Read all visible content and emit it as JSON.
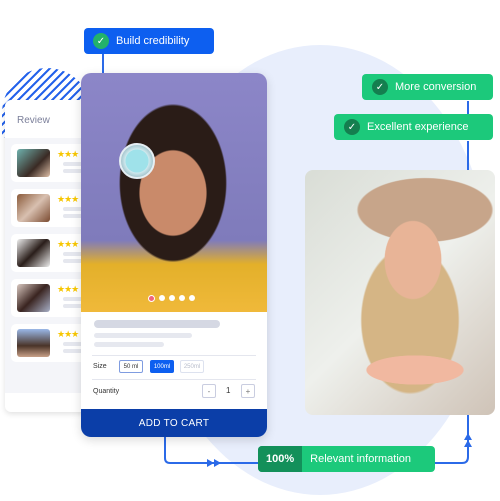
{
  "tags": {
    "build_credibility": "Build credibility",
    "more_conversion": "More conversion",
    "excellent_experience": "Excellent experience",
    "relevant_percent": "100%",
    "relevant_information": "Relevant information"
  },
  "icons": {
    "check": "✓",
    "star": "★★★"
  },
  "review": {
    "title": "Review",
    "items": [
      {
        "stars": "★★★"
      },
      {
        "stars": "★★★"
      },
      {
        "stars": "★★★"
      },
      {
        "stars": "★★★"
      },
      {
        "stars": "★★★"
      }
    ]
  },
  "product": {
    "carousel_total": 5,
    "carousel_active": 1,
    "size_label": "Size",
    "sizes": [
      {
        "label": "50 ml",
        "state": "default"
      },
      {
        "label": "100ml",
        "state": "selected"
      },
      {
        "label": "250ml",
        "state": "disabled"
      }
    ],
    "quantity_label": "Quantity",
    "quantity_minus": "-",
    "quantity_value": "1",
    "quantity_plus": "+",
    "add_to_cart": "ADD TO CART"
  },
  "colors": {
    "primary_blue": "#0d5ff0",
    "cart_blue": "#0b3ea8",
    "green": "#1cc97b",
    "dark_green": "#13905a",
    "star": "#f7c600",
    "connector": "#2b6ae8"
  }
}
